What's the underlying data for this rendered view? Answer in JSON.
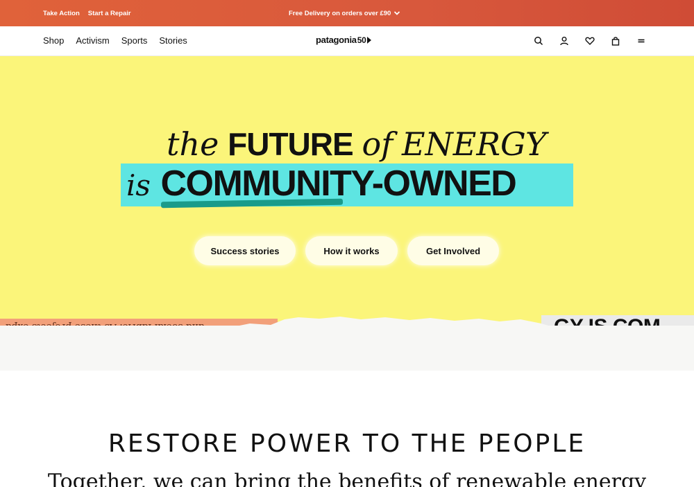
{
  "topbar": {
    "links": [
      "Take Action",
      "Start a Repair"
    ],
    "promo": "Free Delivery on orders over £90"
  },
  "nav": {
    "menu": [
      "Shop",
      "Activism",
      "Sports",
      "Stories"
    ],
    "logo_text": "patagonia",
    "logo_num": "50"
  },
  "hero": {
    "line1": {
      "the": "the",
      "future": "FUTURE",
      "of": "of",
      "energy": "ENERGY"
    },
    "line2": {
      "is": "is",
      "owned": "COMMUNITY-OWNED"
    },
    "buttons": [
      "Success stories",
      "How it works",
      "Get Involved"
    ],
    "strip_left_text": "and social fabric. As these projects expa",
    "strip_right_text": "GY IS COM"
  },
  "section": {
    "title": "RESTORE POWER TO THE PEOPLE",
    "subtitle": "Together, we can bring the benefits of renewable energy"
  },
  "colors": {
    "topbar": "#d8583c",
    "hero_bg": "#fbf57a",
    "highlight": "#5ee5e2",
    "underline": "#1a9b8a"
  }
}
